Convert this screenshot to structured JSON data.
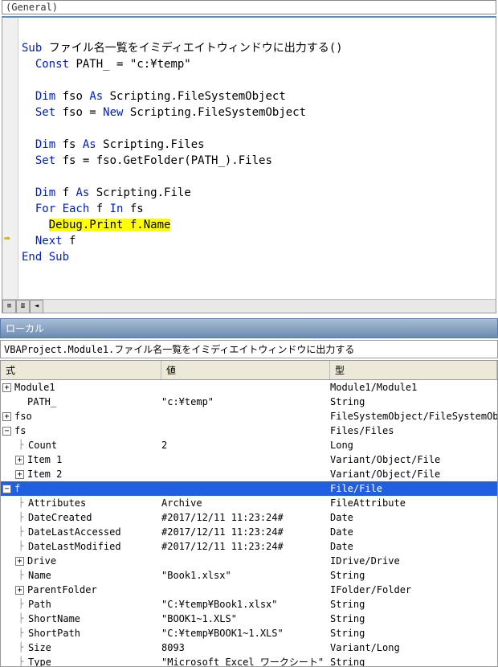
{
  "dropdown": {
    "label": "(General)"
  },
  "code": {
    "sub_kw": "Sub",
    "sub_name": " ファイル名一覧をイミディエイトウィンドウに出力する()",
    "const_kw": "Const",
    "const_line": " PATH_ = \"c:¥temp\"",
    "dim1a": "Dim",
    "dim1b": " fso ",
    "as": "As",
    "dim1c": " Scripting.FileSystemObject",
    "set1a": "Set",
    "set1b": " fso = ",
    "new_kw": "New",
    "set1c": " Scripting.FileSystemObject",
    "dim2a": "Dim",
    "dim2b": " fs ",
    "dim2c": " Scripting.Files",
    "set2a": "Set",
    "set2b": " fs = fso.GetFolder(PATH_).Files",
    "dim3a": "Dim",
    "dim3b": " f ",
    "dim3c": " Scripting.File",
    "for_kw": "For Each",
    "for_mid": " f ",
    "in_kw": "In",
    "for_end": " fs",
    "debug_line": "Debug.Print f.Name",
    "next_kw": "Next",
    "next_var": " f",
    "end_kw": "End Sub"
  },
  "panel_title": "ローカル",
  "context": "VBAProject.Module1.ファイル名一覧をイミディエイトウィンドウに出力する",
  "headers": {
    "expr": "式",
    "val": "値",
    "type": "型"
  },
  "rows": [
    {
      "indent": 0,
      "icon": "plus",
      "expr": "Module1",
      "val": "",
      "type": "Module1/Module1"
    },
    {
      "indent": 1,
      "icon": "",
      "expr": "PATH_",
      "val": "\"c:¥temp\"",
      "type": "String"
    },
    {
      "indent": 0,
      "icon": "plus",
      "expr": "fso",
      "val": "",
      "type": "FileSystemObject/FileSystemObject"
    },
    {
      "indent": 0,
      "icon": "minus",
      "expr": "fs",
      "val": "",
      "type": "Files/Files"
    },
    {
      "indent": 1,
      "icon": "branch",
      "expr": "Count",
      "val": "2",
      "type": "Long"
    },
    {
      "indent": 1,
      "icon": "plus",
      "expr": "Item 1",
      "val": "",
      "type": "Variant/Object/File"
    },
    {
      "indent": 1,
      "icon": "plus",
      "expr": "Item 2",
      "val": "",
      "type": "Variant/Object/File"
    },
    {
      "indent": 0,
      "icon": "minus",
      "expr": "f",
      "val": "",
      "type": "File/File",
      "selected": true
    },
    {
      "indent": 1,
      "icon": "branch",
      "expr": "Attributes",
      "val": "Archive",
      "type": "FileAttribute"
    },
    {
      "indent": 1,
      "icon": "branch",
      "expr": "DateCreated",
      "val": "#2017/12/11 11:23:24#",
      "type": "Date"
    },
    {
      "indent": 1,
      "icon": "branch",
      "expr": "DateLastAccessed",
      "val": "#2017/12/11 11:23:24#",
      "type": "Date"
    },
    {
      "indent": 1,
      "icon": "branch",
      "expr": "DateLastModified",
      "val": "#2017/12/11 11:23:24#",
      "type": "Date"
    },
    {
      "indent": 1,
      "icon": "plus",
      "expr": "Drive",
      "val": "",
      "type": "IDrive/Drive"
    },
    {
      "indent": 1,
      "icon": "branch",
      "expr": "Name",
      "val": "\"Book1.xlsx\"",
      "type": "String"
    },
    {
      "indent": 1,
      "icon": "plus",
      "expr": "ParentFolder",
      "val": "",
      "type": "IFolder/Folder"
    },
    {
      "indent": 1,
      "icon": "branch",
      "expr": "Path",
      "val": "\"C:¥temp¥Book1.xlsx\"",
      "type": "String"
    },
    {
      "indent": 1,
      "icon": "branch",
      "expr": "ShortName",
      "val": "\"BOOK1~1.XLS\"",
      "type": "String"
    },
    {
      "indent": 1,
      "icon": "branch",
      "expr": "ShortPath",
      "val": "\"C:¥temp¥BOOK1~1.XLS\"",
      "type": "String"
    },
    {
      "indent": 1,
      "icon": "branch",
      "expr": "Size",
      "val": "8093",
      "type": "Variant/Long"
    },
    {
      "indent": 1,
      "icon": "branch",
      "expr": "Type",
      "val": "\"Microsoft Excel ワークシート\"",
      "type": "String"
    }
  ]
}
